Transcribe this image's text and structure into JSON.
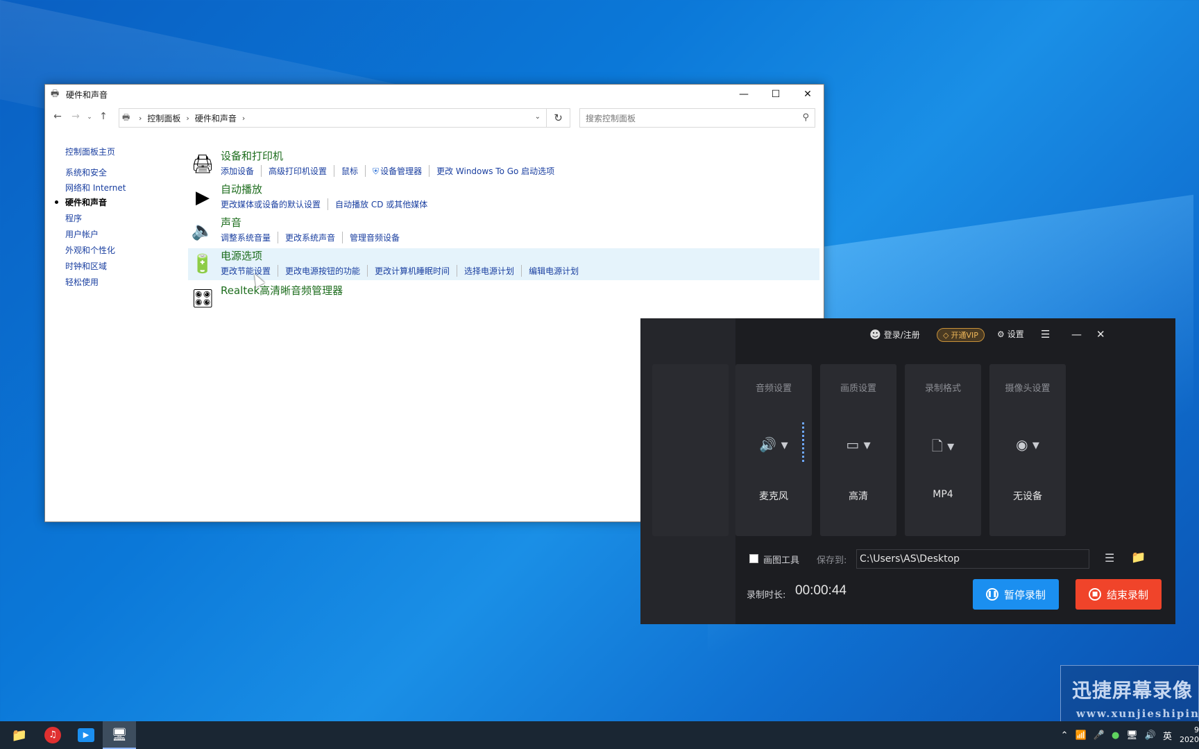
{
  "window": {
    "title": "硬件和声音"
  },
  "address": {
    "crumbs": [
      "控制面板",
      "硬件和声音"
    ],
    "search_placeholder": "搜索控制面板"
  },
  "left_nav": {
    "items": [
      {
        "label": "控制面板主页"
      },
      {
        "label": "系统和安全"
      },
      {
        "label": "网络和 Internet"
      },
      {
        "label": "硬件和声音"
      },
      {
        "label": "程序"
      },
      {
        "label": "用户帐户"
      },
      {
        "label": "外观和个性化"
      },
      {
        "label": "时钟和区域"
      },
      {
        "label": "轻松使用"
      }
    ],
    "active": "硬件和声音"
  },
  "categories": [
    {
      "title": "设备和打印机",
      "icon": "printer-icon",
      "links": [
        "添加设备",
        "高级打印机设置",
        "鼠标",
        "设备管理器",
        "更改 Windows To Go 启动选项"
      ]
    },
    {
      "title": "自动播放",
      "icon": "autoplay-icon",
      "links": [
        "更改媒体或设备的默认设置",
        "自动播放 CD 或其他媒体"
      ]
    },
    {
      "title": "声音",
      "icon": "speaker-icon",
      "links": [
        "调整系统音量",
        "更改系统声音",
        "管理音频设备"
      ]
    },
    {
      "title": "电源选项",
      "icon": "battery-icon",
      "links": [
        "更改节能设置",
        "更改电源按钮的功能",
        "更改计算机睡眠时间",
        "选择电源计划",
        "编辑电源计划"
      ]
    },
    {
      "title": "Realtek高清晰音频管理器",
      "icon": "realtek-icon",
      "links": []
    }
  ],
  "recorder": {
    "login_label": "登录/注册",
    "vip_label": "开通VIP",
    "settings_label": "设置",
    "cards": [
      {
        "title": "音频设置",
        "value": "麦克风",
        "icon": "microphone-icon"
      },
      {
        "title": "画质设置",
        "value": "高清",
        "icon": "monitor-icon"
      },
      {
        "title": "录制格式",
        "value": "MP4",
        "icon": "file-icon"
      },
      {
        "title": "摄像头设置",
        "value": "无设备",
        "icon": "camera-icon"
      }
    ],
    "draw_tool_label": "画图工具",
    "save_to_label": "保存到:",
    "save_path": "C:\\Users\\AS\\Desktop",
    "duration_label": "录制时长:",
    "duration": "00:00:44",
    "pause_label": "暂停录制",
    "stop_label": "结束录制"
  },
  "watermark": {
    "cn": "迅捷屏幕录像",
    "en": "www.xunjieshipin"
  },
  "taskbar": {
    "ime": "英",
    "clock_line1": "9",
    "clock_line2": "2020"
  }
}
